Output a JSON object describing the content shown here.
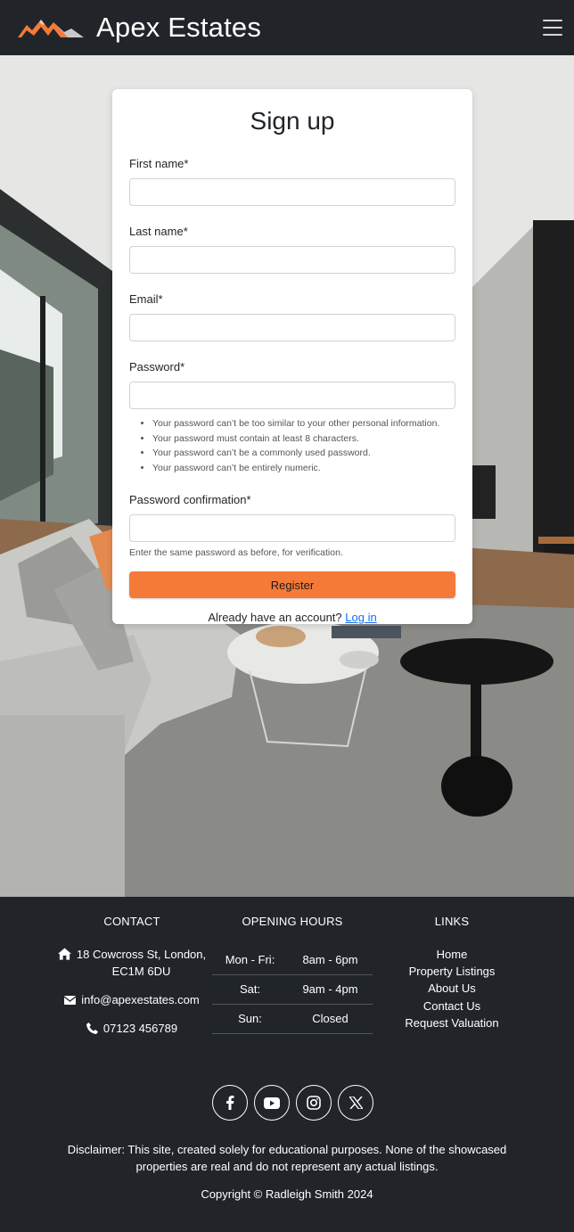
{
  "brand": {
    "name": "Apex Estates",
    "logo_icon": "mountain-logo-icon",
    "accent": "#f57a3a"
  },
  "nav": {
    "menu_icon": "hamburger-menu-icon"
  },
  "signup": {
    "title": "Sign up",
    "first_name_label": "First name*",
    "last_name_label": "Last name*",
    "email_label": "Email*",
    "password_label": "Password*",
    "password_help": [
      "Your password can’t be too similar to your other personal information.",
      "Your password must contain at least 8 characters.",
      "Your password can’t be a commonly used password.",
      "Your password can’t be entirely numeric."
    ],
    "password_confirm_label": "Password confirmation*",
    "password_confirm_help": "Enter the same password as before, for verification.",
    "register_label": "Register",
    "login_prompt": "Already have an account?",
    "login_link": "Log in"
  },
  "footer": {
    "contact_title": "CONTACT",
    "address_line1": "18 Cowcross St, London,",
    "address_line2": "EC1M 6DU",
    "email": "info@apexestates.com",
    "phone": "07123 456789",
    "hours_title": "OPENING HOURS",
    "hours": [
      {
        "day": "Mon - Fri:",
        "time": "8am - 6pm"
      },
      {
        "day": "Sat:",
        "time": "9am - 4pm"
      },
      {
        "day": "Sun:",
        "time": "Closed"
      }
    ],
    "links_title": "LINKS",
    "links": [
      "Home",
      "Property Listings",
      "About Us",
      "Contact Us",
      "Request Valuation"
    ],
    "socials": [
      "facebook-icon",
      "youtube-icon",
      "instagram-icon",
      "x-twitter-icon"
    ],
    "disclaimer": "Disclaimer: This site, created solely for educational purposes. None of the showcased properties are real and do not represent any actual listings.",
    "copyright": "Copyright © Radleigh Smith 2024"
  }
}
